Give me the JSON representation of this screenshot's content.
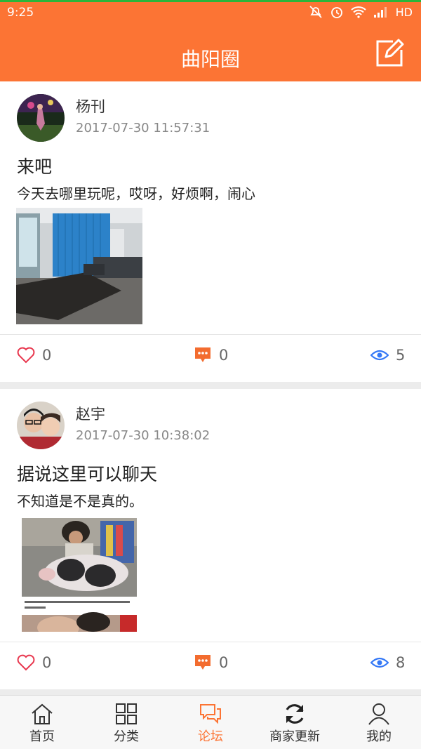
{
  "status_bar": {
    "time": "9:25",
    "network": "HD"
  },
  "header": {
    "title": "曲阳圈",
    "edit_icon": "edit-icon"
  },
  "colors": {
    "accent": "#fc7434",
    "eye": "#3478f6",
    "comment": "#f36c2f",
    "like": "#e8374e"
  },
  "posts": [
    {
      "author": "杨刊",
      "time": "2017-07-30 11:57:31",
      "title": "来吧",
      "body": "今天去哪里玩呢，哎呀，好烦啊，闹心",
      "likes": "0",
      "comments": "0",
      "views": "5"
    },
    {
      "author": "赵宇",
      "time": "2017-07-30 10:38:02",
      "title": "据说这里可以聊天",
      "body": "不知道是不是真的。",
      "likes": "0",
      "comments": "0",
      "views": "8"
    }
  ],
  "tabs": [
    {
      "label": "首页",
      "icon": "home-icon"
    },
    {
      "label": "分类",
      "icon": "category-icon"
    },
    {
      "label": "论坛",
      "icon": "forum-icon",
      "active": true
    },
    {
      "label": "商家更新",
      "icon": "refresh-icon"
    },
    {
      "label": "我的",
      "icon": "person-icon"
    }
  ]
}
